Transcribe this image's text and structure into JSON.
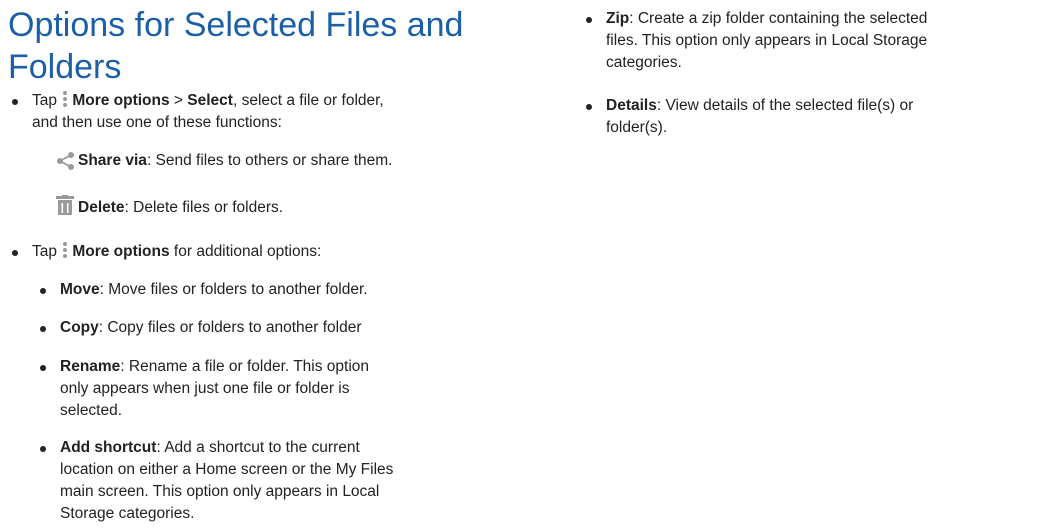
{
  "heading": "Options for Selected Files and Folders",
  "heading_line1": "Options for Selected Files and",
  "heading_line2": "Folders",
  "bullet1": {
    "prefix": "Tap ",
    "more_options": "More options",
    "sep": " > ",
    "select": "Select",
    "rest_line1": ", select a file or folder,",
    "line2": "and then use one of these functions:"
  },
  "share": {
    "icon": "share-icon",
    "label": "Share via",
    "text": ": Send files to others or share them."
  },
  "delete": {
    "icon": "trash-icon",
    "label": "Delete",
    "text": ": Delete files or folders."
  },
  "bullet2": {
    "prefix": "Tap ",
    "more_options": "More options",
    "rest": " for additional options:"
  },
  "sub": {
    "move": {
      "label": "Move",
      "text": ": Move files or folders to another folder."
    },
    "copy": {
      "label": "Copy",
      "text": ": Copy files or folders to another folder"
    },
    "rename": {
      "label": "Rename",
      "line1": ": Rename a file or folder. This option",
      "line2": "only appears when just one file or folder is",
      "line3": "selected."
    },
    "shortcut": {
      "label": "Add shortcut",
      "line1": ": Add a shortcut to the current",
      "line2": "location on either a Home screen or the My Files",
      "line3": "main screen. This option only appears in Local",
      "line4": "Storage categories."
    }
  },
  "right": {
    "zip": {
      "label": "Zip",
      "line1": ": Create a zip folder containing the selected",
      "line2": "files. This option only appears in Local Storage",
      "line3": "categories."
    },
    "details": {
      "label": "Details",
      "line1": ": View details of the selected file(s) or",
      "line2": "folder(s)."
    }
  },
  "colors": {
    "heading": "#1b5fa8",
    "text": "#222222",
    "icon": "#9a9a9a"
  }
}
